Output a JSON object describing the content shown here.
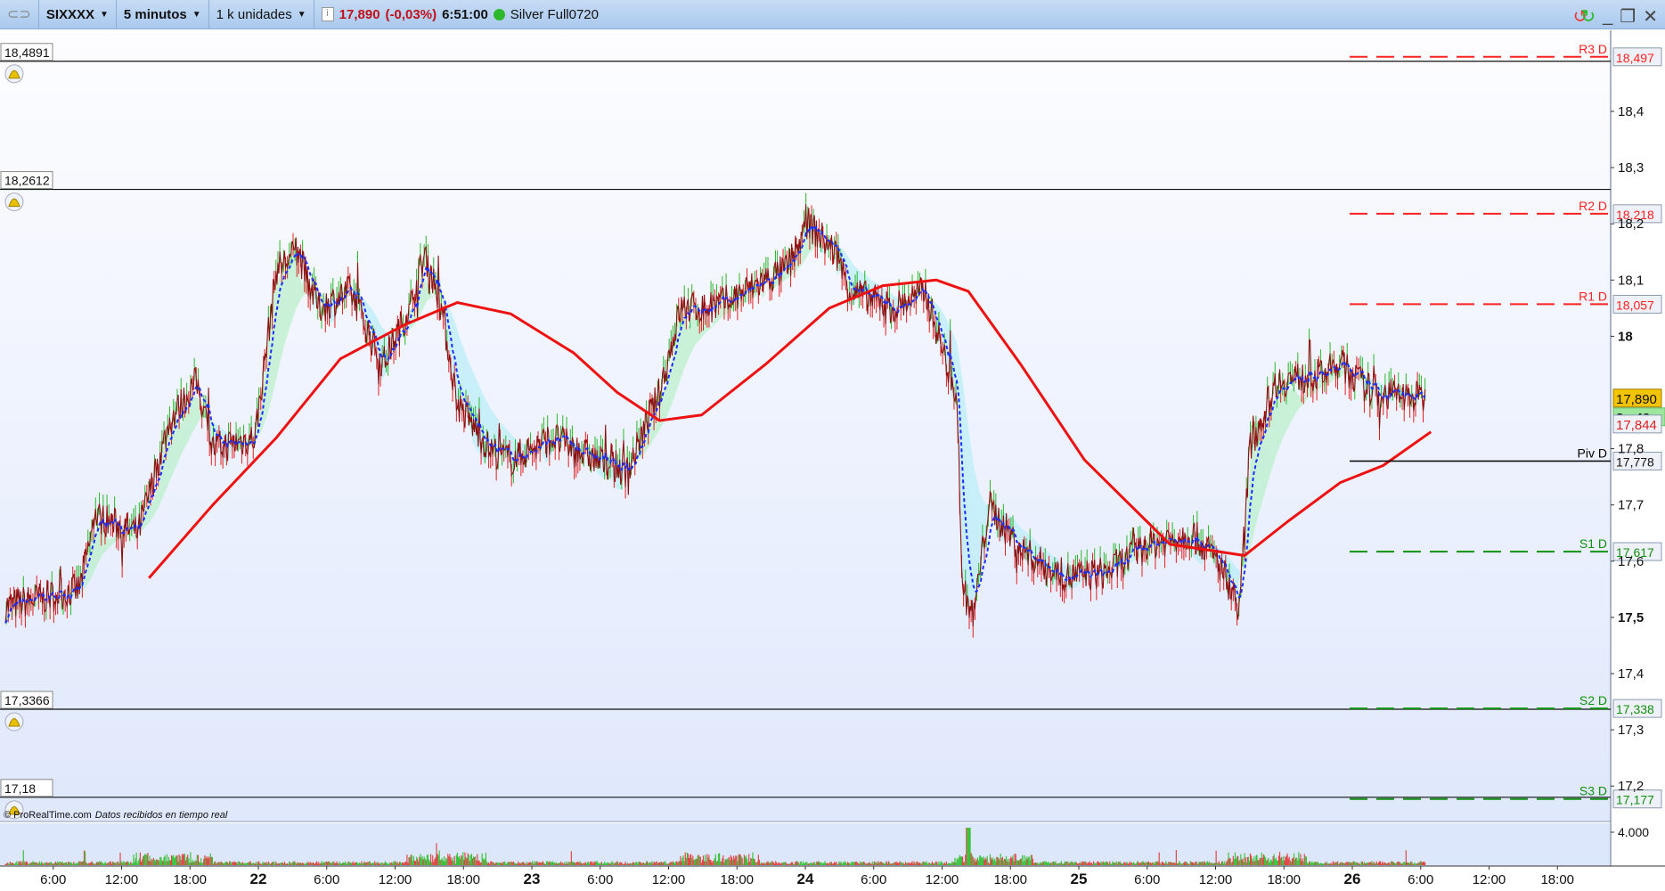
{
  "toolbar": {
    "symbol": "SIXXXX",
    "interval": "5 minutos",
    "units": "1 k unidades",
    "price": "17,890",
    "change": "(-0,03%)",
    "time": "6:51:00",
    "feed": "Silver Full0720",
    "feed_status_color": "#2eb82e"
  },
  "footer": {
    "copyright": "© ProRealTime.com",
    "status": "Datos recibidos en tiempo real"
  },
  "price_axis": {
    "ticks": [
      {
        "v": 18.4,
        "l": "18,4"
      },
      {
        "v": 18.3,
        "l": "18,3"
      },
      {
        "v": 18.2,
        "l": "18,2"
      },
      {
        "v": 18.1,
        "l": "18,1"
      },
      {
        "v": 18.0,
        "l": "18",
        "bold": true
      },
      {
        "v": 17.8,
        "l": "17,8"
      },
      {
        "v": 17.7,
        "l": "17,7"
      },
      {
        "v": 17.6,
        "l": "17,6"
      },
      {
        "v": 17.5,
        "l": "17,5",
        "bold": true
      },
      {
        "v": 17.4,
        "l": "17,4"
      },
      {
        "v": 17.3,
        "l": "17,3"
      },
      {
        "v": 17.2,
        "l": "17,2"
      }
    ],
    "last_price": "17,890",
    "countdown": "3m49s",
    "ma_value": "17,844",
    "last_price_value": 17.89,
    "ma_last_value": 17.844
  },
  "levels": [
    {
      "name": "R3 D",
      "value": 18.497,
      "label": "18,497",
      "color": "#ff2020"
    },
    {
      "name": "R2 D",
      "value": 18.218,
      "label": "18,218",
      "color": "#ff2020"
    },
    {
      "name": "R1 D",
      "value": 18.057,
      "label": "18,057",
      "color": "#ff2020"
    },
    {
      "name": "Piv D",
      "value": 17.778,
      "label": "17,778",
      "color": "#000000"
    },
    {
      "name": "S1 D",
      "value": 17.617,
      "label": "17,617",
      "color": "#109010"
    },
    {
      "name": "S2 D",
      "value": 17.338,
      "label": "17,338",
      "color": "#109010"
    },
    {
      "name": "S3 D",
      "value": 17.177,
      "label": "17,177",
      "color": "#109010"
    }
  ],
  "alerts": [
    {
      "value": 18.4891,
      "label": "18,4891"
    },
    {
      "value": 18.2612,
      "label": "18,2612"
    },
    {
      "value": 17.3366,
      "label": "17,3366"
    },
    {
      "value": 17.18,
      "label": "17,18"
    }
  ],
  "volume_axis": {
    "label": "4.000"
  },
  "time_axis": [
    {
      "t": "21 06:00",
      "l": "6:00"
    },
    {
      "t": "21 12:00",
      "l": "12:00"
    },
    {
      "t": "21 18:00",
      "l": "18:00"
    },
    {
      "t": "22 00:00",
      "l": "22",
      "bold": true
    },
    {
      "t": "22 06:00",
      "l": "6:00"
    },
    {
      "t": "22 12:00",
      "l": "12:00"
    },
    {
      "t": "22 18:00",
      "l": "18:00"
    },
    {
      "t": "23 00:00",
      "l": "23",
      "bold": true
    },
    {
      "t": "23 06:00",
      "l": "6:00"
    },
    {
      "t": "23 12:00",
      "l": "12:00"
    },
    {
      "t": "23 18:00",
      "l": "18:00"
    },
    {
      "t": "24 00:00",
      "l": "24",
      "bold": true
    },
    {
      "t": "24 06:00",
      "l": "6:00"
    },
    {
      "t": "24 12:00",
      "l": "12:00"
    },
    {
      "t": "24 18:00",
      "l": "18:00"
    },
    {
      "t": "25 00:00",
      "l": "25",
      "bold": true
    },
    {
      "t": "25 06:00",
      "l": "6:00"
    },
    {
      "t": "25 12:00",
      "l": "12:00"
    },
    {
      "t": "25 18:00",
      "l": "18:00"
    },
    {
      "t": "26 00:00",
      "l": "26",
      "bold": true
    },
    {
      "t": "26 06:00",
      "l": "6:00"
    },
    {
      "t": "26 12:00",
      "l": "12:00"
    },
    {
      "t": "26 18:00",
      "l": "18:00"
    }
  ],
  "chart_data": {
    "type": "line",
    "ylim": [
      17.1,
      18.55
    ],
    "colors": {
      "price": "#8b1010",
      "ma": "#ee1111",
      "signal": "#1a2eff",
      "cloud_up": "#b8f0c8",
      "cloud_down": "#b8eef8"
    },
    "price": [
      [
        "21 01:48",
        17.52
      ],
      [
        "21 08:18",
        17.55
      ],
      [
        "21 09:42",
        17.68
      ],
      [
        "21 13:27",
        17.65
      ],
      [
        "21 16:15",
        17.85
      ],
      [
        "21 18:36",
        17.92
      ],
      [
        "21 20:00",
        17.8
      ],
      [
        "21 23:42",
        17.82
      ],
      [
        "22 01:36",
        18.12
      ],
      [
        "22 03:27",
        18.15
      ],
      [
        "22 05:18",
        18.05
      ],
      [
        "22 08:06",
        18.08
      ],
      [
        "22 10:54",
        17.95
      ],
      [
        "22 13:15",
        18.05
      ],
      [
        "22 14:39",
        18.15
      ],
      [
        "22 16:04",
        18.05
      ],
      [
        "22 17:28",
        17.88
      ],
      [
        "22 20:16",
        17.8
      ],
      [
        "22 22:08",
        17.78
      ],
      [
        "23 01:52",
        17.82
      ],
      [
        "23 05:36",
        17.78
      ],
      [
        "23 08:24",
        17.76
      ],
      [
        "23 11:12",
        17.9
      ],
      [
        "23 13:04",
        18.05
      ],
      [
        "23 15:52",
        18.05
      ],
      [
        "23 18:40",
        18.08
      ],
      [
        "23 22:24",
        18.12
      ],
      [
        "24 00:16",
        18.2
      ],
      [
        "24 02:36",
        18.15
      ],
      [
        "24 04:00",
        18.08
      ],
      [
        "24 07:44",
        18.05
      ],
      [
        "24 10:32",
        18.08
      ],
      [
        "24 12:24",
        17.95
      ],
      [
        "24 13:18",
        17.9
      ],
      [
        "24 13:48",
        17.55
      ],
      [
        "24 14:45",
        17.5
      ],
      [
        "24 16:06",
        17.7
      ],
      [
        "24 18:54",
        17.62
      ],
      [
        "24 22:42",
        17.57
      ],
      [
        "25 02:24",
        17.58
      ],
      [
        "25 06:09",
        17.63
      ],
      [
        "25 09:54",
        17.65
      ],
      [
        "25 12:12",
        17.6
      ],
      [
        "25 14:06",
        17.52
      ],
      [
        "25 15:00",
        17.8
      ],
      [
        "25 17:21",
        17.92
      ],
      [
        "25 21:06",
        17.93
      ],
      [
        "25 22:58",
        17.95
      ],
      [
        "26 01:46",
        17.9
      ],
      [
        "26 06:24",
        17.89
      ]
    ],
    "ma": [
      [
        "21 14:24",
        17.57
      ],
      [
        "21 20:00",
        17.7
      ],
      [
        "22 01:36",
        17.82
      ],
      [
        "22 07:12",
        17.96
      ],
      [
        "22 12:48",
        18.02
      ],
      [
        "22 17:28",
        18.06
      ],
      [
        "22 22:08",
        18.04
      ],
      [
        "23 03:42",
        17.97
      ],
      [
        "23 07:30",
        17.9
      ],
      [
        "23 11:12",
        17.85
      ],
      [
        "23 14:54",
        17.86
      ],
      [
        "23 20:30",
        17.95
      ],
      [
        "24 02:06",
        18.05
      ],
      [
        "24 06:48",
        18.09
      ],
      [
        "24 11:30",
        18.1
      ],
      [
        "24 14:18",
        18.08
      ],
      [
        "24 18:54",
        17.95
      ],
      [
        "25 00:30",
        17.78
      ],
      [
        "25 08:00",
        17.63
      ],
      [
        "25 14:33",
        17.61
      ],
      [
        "25 18:18",
        17.67
      ],
      [
        "25 22:58",
        17.74
      ],
      [
        "26 02:42",
        17.77
      ],
      [
        "26 06:54",
        17.83
      ]
    ]
  }
}
